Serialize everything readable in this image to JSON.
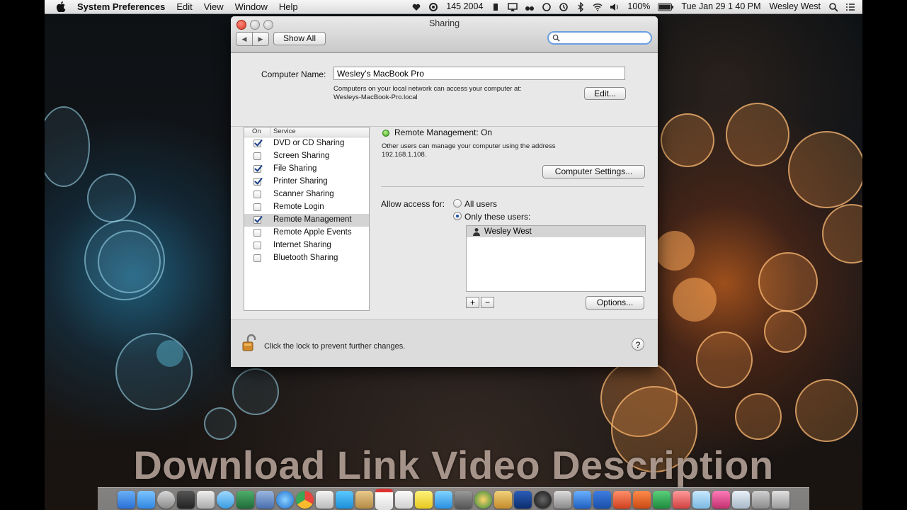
{
  "menubar": {
    "app_name": "System Preferences",
    "menus": [
      "Edit",
      "View",
      "Window",
      "Help"
    ],
    "status_text": "145 2004",
    "battery": "100%",
    "clock": "Tue Jan 29  1 40 PM",
    "user": "Wesley West"
  },
  "window": {
    "title": "Sharing",
    "show_all_label": "Show All",
    "search_placeholder": "",
    "computer_name_label": "Computer Name:",
    "computer_name_value": "Wesley’s MacBook Pro",
    "computer_name_hint_1": "Computers on your local network can access your computer at:",
    "computer_name_hint_2": "Wesleys-MacBook-Pro.local",
    "edit_label": "Edit...",
    "services_header": {
      "on": "On",
      "service": "Service"
    },
    "services": [
      {
        "label": "DVD or CD Sharing",
        "on": true,
        "selected": false
      },
      {
        "label": "Screen Sharing",
        "on": false,
        "selected": false
      },
      {
        "label": "File Sharing",
        "on": true,
        "selected": false
      },
      {
        "label": "Printer Sharing",
        "on": true,
        "selected": false
      },
      {
        "label": "Scanner Sharing",
        "on": false,
        "selected": false
      },
      {
        "label": "Remote Login",
        "on": false,
        "selected": false
      },
      {
        "label": "Remote Management",
        "on": true,
        "selected": true
      },
      {
        "label": "Remote Apple Events",
        "on": false,
        "selected": false
      },
      {
        "label": "Internet Sharing",
        "on": false,
        "selected": false
      },
      {
        "label": "Bluetooth Sharing",
        "on": false,
        "selected": false
      }
    ],
    "status_title": "Remote Management: On",
    "status_desc_1": "Other users can manage your computer using the address",
    "status_desc_2": "192.168.1.108.",
    "computer_settings_label": "Computer Settings...",
    "allow_access_label": "Allow access for:",
    "radio_all_users": "All users",
    "radio_only_these": "Only these users:",
    "selected_access": "only_these",
    "users": [
      "Wesley West"
    ],
    "plus_label": "+",
    "minus_label": "−",
    "options_label": "Options...",
    "lock_text": "Click the lock to prevent further changes.",
    "help_label": "?"
  },
  "overlay_text": "Download Link Video Description",
  "colors": {
    "status_led": "#3ea01c",
    "search_focus": "#6aa0e0",
    "selection": "#d4d4d4"
  }
}
